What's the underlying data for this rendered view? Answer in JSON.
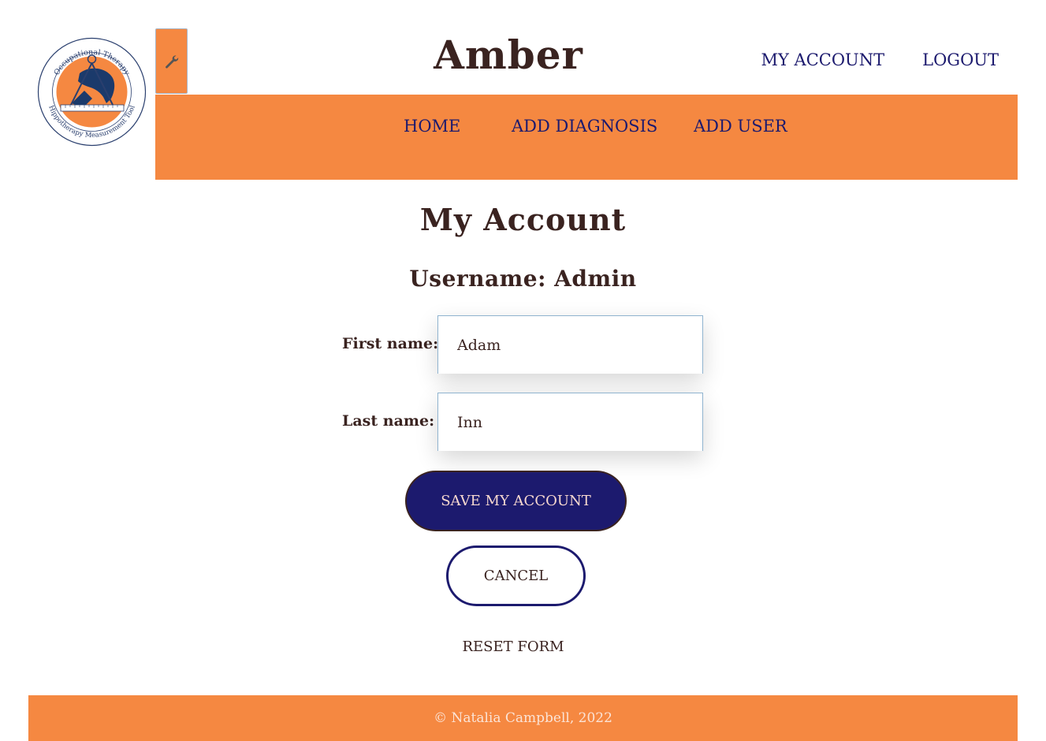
{
  "header": {
    "title": "Amber",
    "logo": {
      "top_text": "Occupational Therapy",
      "bottom_text": "Hippotherapy Measurement Tool",
      "icon": "horse-protractor-logo"
    },
    "settings_icon": "wrench-icon",
    "top_links": {
      "my_account": "MY ACCOUNT",
      "logout": "LOGOUT"
    }
  },
  "nav": {
    "home": "HOME",
    "add_diagnosis": "ADD DIAGNOSIS",
    "add_user": "ADD USER"
  },
  "main": {
    "title": "My Account",
    "username_line": "Username: Admin",
    "first_name": {
      "label": "First name:",
      "value": "Adam"
    },
    "last_name": {
      "label": "Last name:",
      "value": "Inn"
    },
    "save_label": "SAVE MY ACCOUNT",
    "cancel_label": "CANCEL",
    "reset_label": "RESET FORM"
  },
  "footer": {
    "text": "© Natalia Campbell, 2022"
  },
  "colors": {
    "accent_orange": "#f58841",
    "navy": "#1c1a6e",
    "text_brown": "#3a2320"
  }
}
